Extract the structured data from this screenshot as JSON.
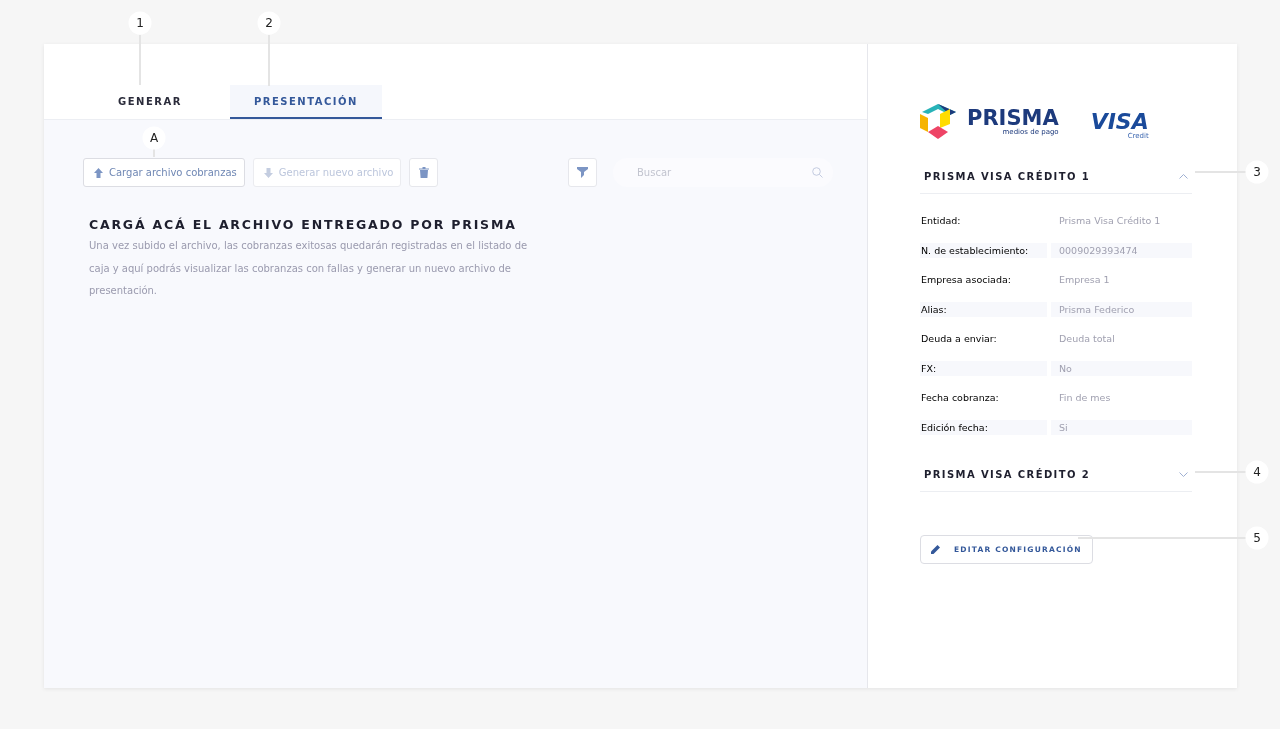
{
  "tabs": [
    {
      "label": "GENERAR",
      "selected": false
    },
    {
      "label": "PRESENTACIÓN",
      "selected": true
    }
  ],
  "toolbar": {
    "buttons": [
      {
        "kind": "upload",
        "label": "Cargar archivo cobranzas",
        "disabled": false
      },
      {
        "kind": "download",
        "label": "Generar nuevo archivo",
        "disabled": true
      },
      {
        "kind": "delete",
        "disabled": false
      }
    ],
    "search": {
      "placeholder": "Buscar"
    }
  },
  "intro": {
    "title": "CARGÁ ACÁ EL ARCHIVO ENTREGADO POR PRISMA",
    "text": "Una vez subido el archivo, las cobranzas exitosas quedarán registradas en el listado de caja y aquí podrás visualizar las cobranzas con fallas y generar un nuevo archivo de presentación."
  },
  "logos": {
    "prisma": "PRISMA",
    "prisma_tagline": "medios de pago",
    "visa": "VISA",
    "visa_tagline": "Credit"
  },
  "sections": [
    {
      "title": "PRISMA VISA CRÉDITO 1",
      "expanded": true,
      "fields": [
        {
          "label": "Entidad:",
          "value": "Prisma Visa Crédito 1"
        },
        {
          "label": "N. de establecimiento:",
          "value": "0009029393474"
        },
        {
          "label": "Empresa asociada:",
          "value": "Empresa 1"
        },
        {
          "label": "Alias:",
          "value": "Prisma Federico"
        },
        {
          "label": "Deuda a enviar:",
          "value": "Deuda total"
        },
        {
          "label": "FX:",
          "value": "No"
        },
        {
          "label": "Fecha cobranza:",
          "value": "Fin de mes"
        },
        {
          "label": "Edición fecha:",
          "value": "Si"
        }
      ]
    },
    {
      "title": "PRISMA VISA CRÉDITO 2",
      "expanded": false
    }
  ],
  "edit_button": {
    "label": "EDITAR CONFIGURACIÓN"
  },
  "callouts": [
    {
      "label": "1"
    },
    {
      "label": "2"
    },
    {
      "label": "A"
    },
    {
      "label": "3"
    },
    {
      "label": "4"
    },
    {
      "label": "5"
    }
  ]
}
